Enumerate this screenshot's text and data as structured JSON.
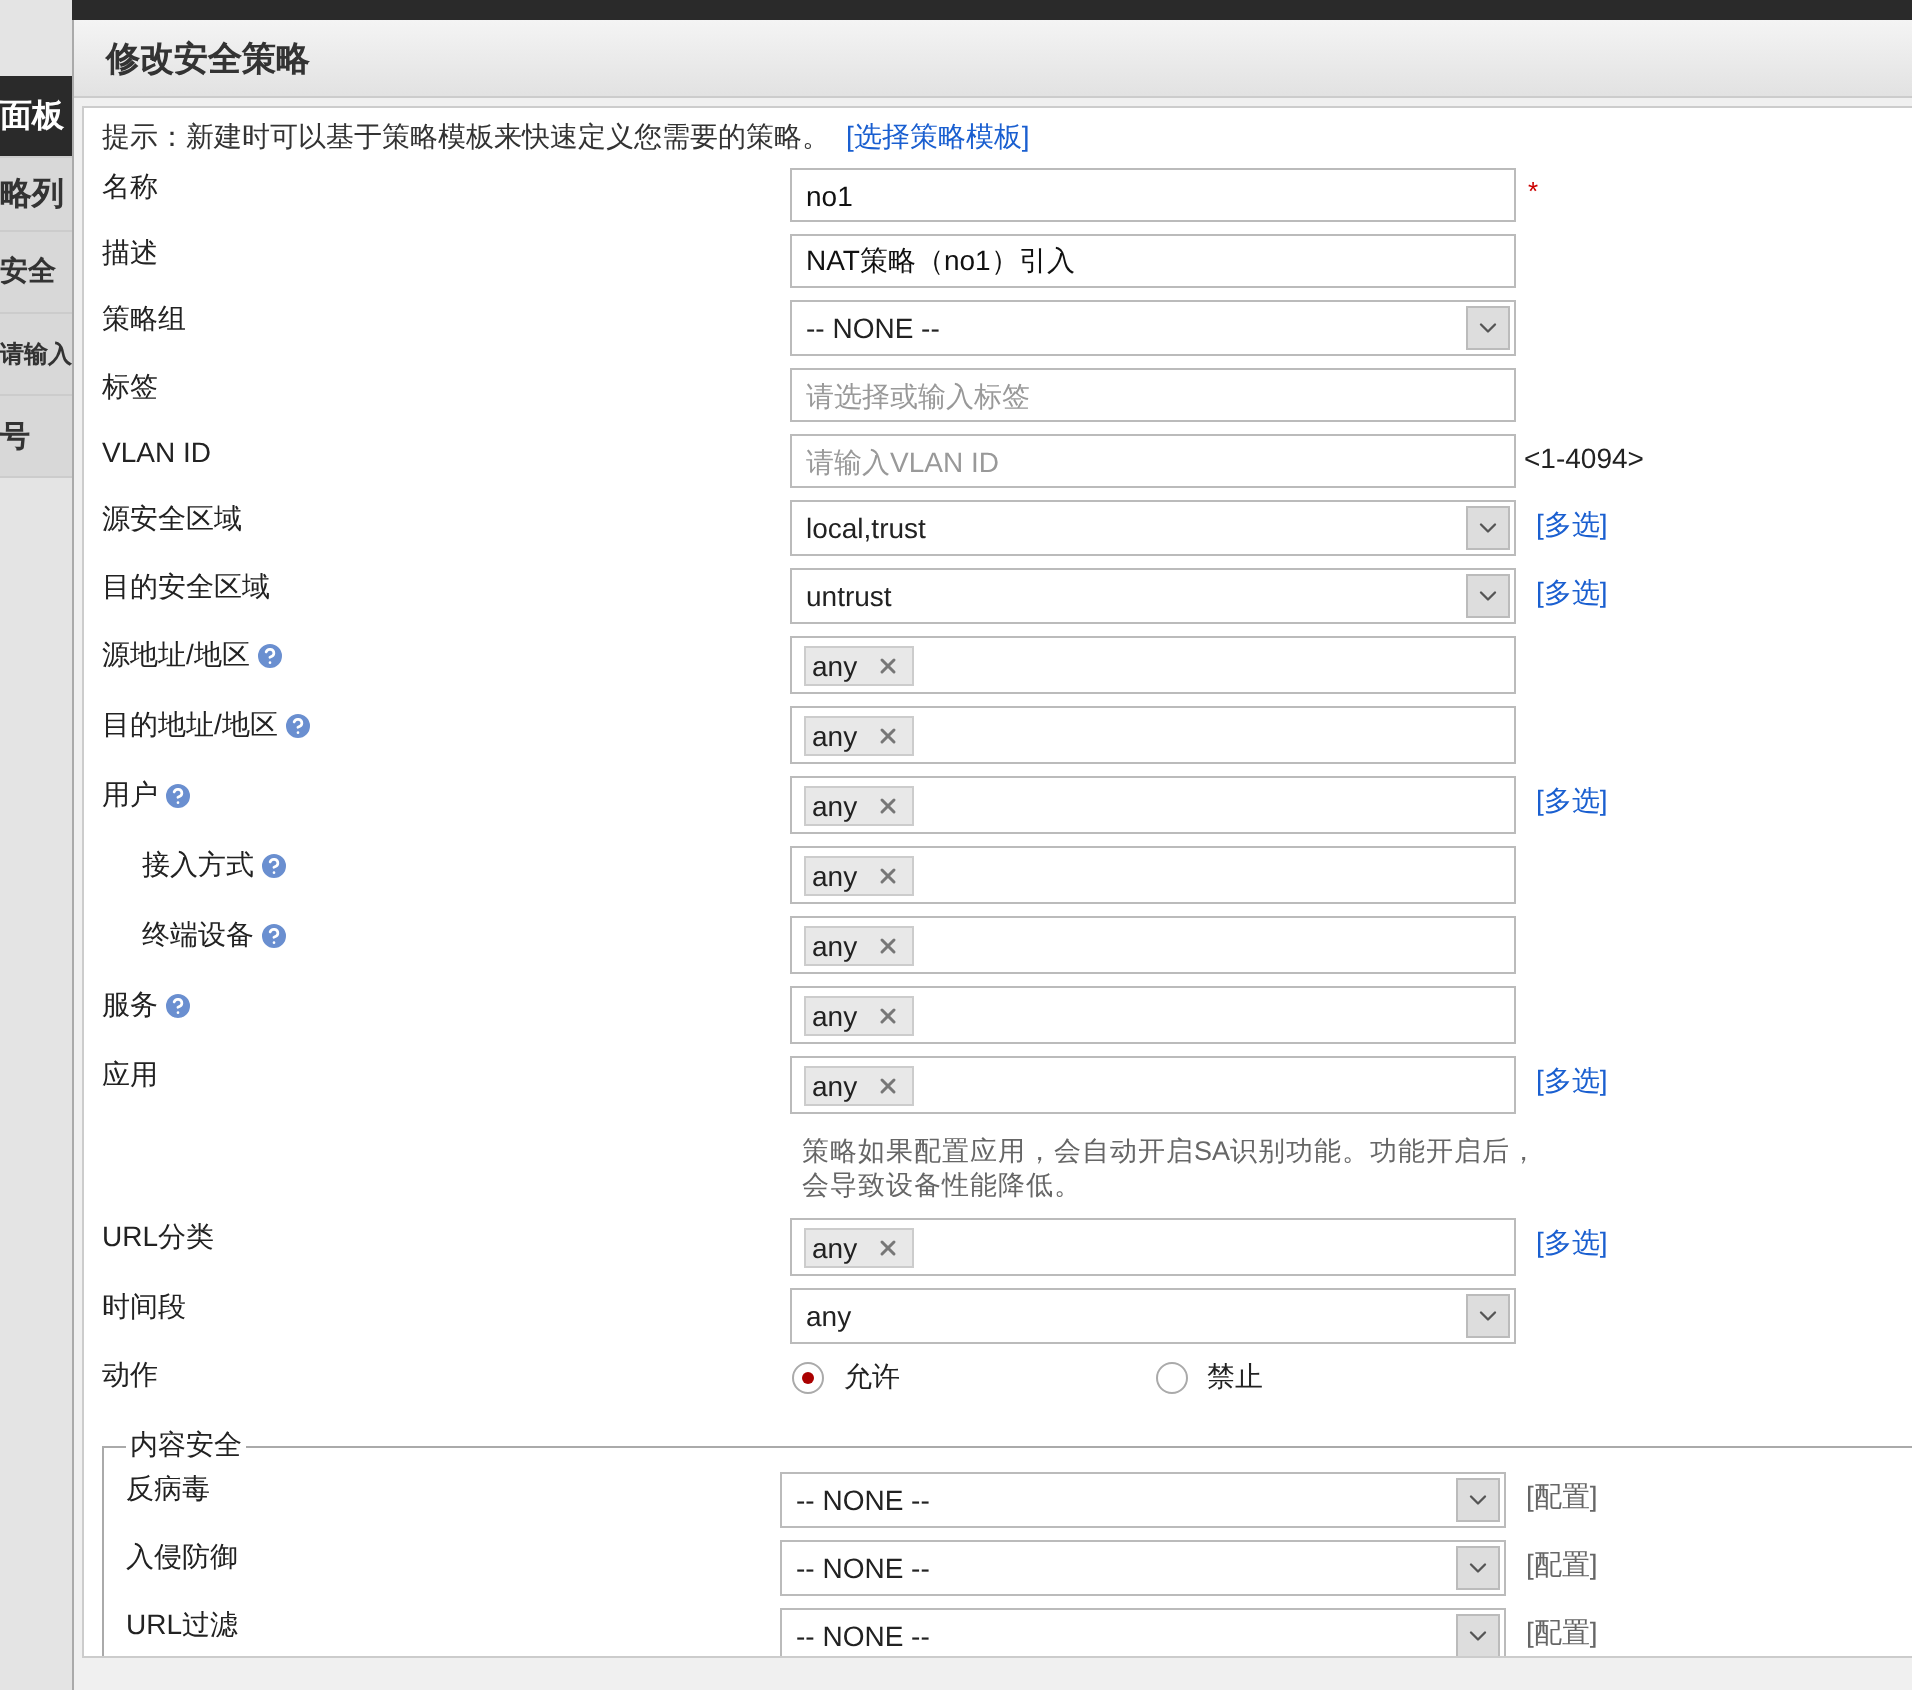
{
  "background": {
    "items": [
      "面板",
      "略列",
      "安全",
      "请输入",
      "号"
    ]
  },
  "dialog": {
    "title": "修改安全策略",
    "hint": {
      "text": "提示：新建时可以基于策略模板来快速定义您需要的策略。",
      "link": "[选择策略模板]"
    },
    "fields": [
      {
        "kind": "text",
        "label": "名称",
        "value": "no1",
        "mark": "*"
      },
      {
        "kind": "text",
        "label": "描述",
        "value": "NAT策略（no1）引入"
      },
      {
        "kind": "select",
        "label": "策略组",
        "value": "-- NONE --"
      },
      {
        "kind": "text",
        "label": "标签",
        "placeholder": "请选择或输入标签"
      },
      {
        "kind": "text",
        "label": "VLAN ID",
        "placeholder": "请输入VLAN ID",
        "suffix": "<1-4094>"
      },
      {
        "kind": "select",
        "label": "源安全区域",
        "value": "local,trust",
        "link": "[多选]"
      },
      {
        "kind": "select",
        "label": "目的安全区域",
        "value": "untrust",
        "link": "[多选]"
      },
      {
        "kind": "tags",
        "label": "源地址/地区",
        "help": true,
        "tags": [
          "any"
        ]
      },
      {
        "kind": "tags",
        "label": "目的地址/地区",
        "help": true,
        "tags": [
          "any"
        ]
      },
      {
        "kind": "tags",
        "label": "用户",
        "help": true,
        "tags": [
          "any"
        ],
        "link": "[多选]",
        "children": [
          {
            "kind": "tags",
            "label": "接入方式",
            "help": true,
            "tags": [
              "any"
            ]
          },
          {
            "kind": "tags",
            "label": "终端设备",
            "help": true,
            "tags": [
              "any"
            ]
          }
        ]
      },
      {
        "kind": "tags",
        "label": "服务",
        "help": true,
        "tags": [
          "any"
        ]
      },
      {
        "kind": "tags",
        "label": "应用",
        "tags": [
          "any"
        ],
        "link": "[多选]",
        "note": "策略如果配置应用，会自动开启SA识别功能。功能开启后，会导致设备性能降低。"
      },
      {
        "kind": "tags",
        "label": "URL分类",
        "tags": [
          "any"
        ],
        "link": "[多选]"
      },
      {
        "kind": "select",
        "label": "时间段",
        "value": "any"
      },
      {
        "kind": "radio",
        "label": "动作",
        "options": [
          {
            "label": "允许",
            "selected": true
          },
          {
            "label": "禁止",
            "selected": false
          }
        ]
      }
    ],
    "content_security": {
      "legend": "内容安全",
      "rows": [
        {
          "label": "反病毒",
          "value": "-- NONE --",
          "link": "[配置]"
        },
        {
          "label": "入侵防御",
          "value": "-- NONE --",
          "link": "[配置]"
        },
        {
          "label": "URL过滤",
          "value": "-- NONE --",
          "link": "[配置]"
        }
      ]
    }
  }
}
